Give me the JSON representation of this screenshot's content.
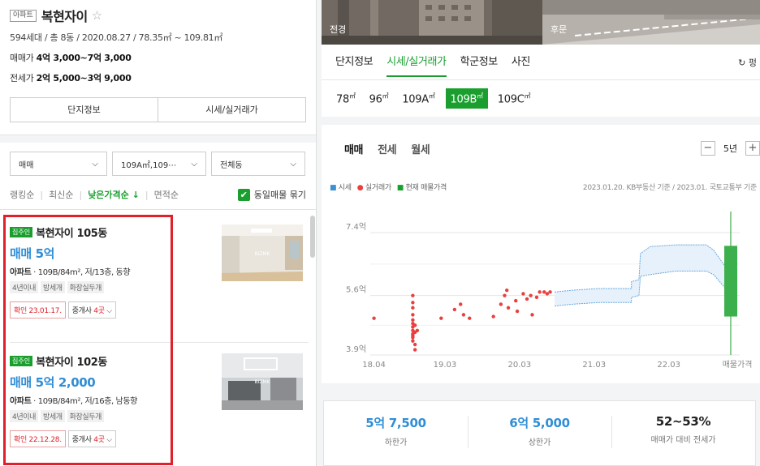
{
  "complex": {
    "type_badge": "아파트",
    "name": "복현자이",
    "meta": "594세대 / 총 8동 / 2020.08.27 / 78.35㎡ ~ 109.81㎡",
    "sale_label": "매매가",
    "sale_range": "4억 3,000~7억 3,000",
    "jeonse_label": "전세가",
    "jeonse_range": "2억 5,000~3억 9,000",
    "btn_info": "단지정보",
    "btn_price": "시세/실거래가"
  },
  "filters": {
    "trade": "매매",
    "size": "109A㎡,109⋯",
    "dong": "전체동"
  },
  "sort": {
    "ranking": "랭킹순",
    "latest": "최신순",
    "low_price": "낮은가격순",
    "low_price_arrow": "↓",
    "area": "면적순",
    "group_label": "동일매물 묶기"
  },
  "listings": [
    {
      "owner_badge": "집주인",
      "name": "복현자이 105동",
      "price": "매매 5억",
      "type": "아파트",
      "desc": "109B/84m², 저/13층, 동향",
      "tags": [
        "4년이내",
        "방세개",
        "화장실두개"
      ],
      "confirm": "확인 23.01.17.",
      "agents_prefix": "중개사 ",
      "agents_count": "4곳"
    },
    {
      "owner_badge": "집주인",
      "name": "복현자이 102동",
      "price": "매매 5억 2,000",
      "type": "아파트",
      "desc": "109B/84m², 저/16층, 남동향",
      "tags": [
        "4년이내",
        "방세개",
        "화장실두개"
      ],
      "confirm": "확인 22.12.28.",
      "agents_prefix": "중개사 ",
      "agents_count": "4곳"
    }
  ],
  "photos": {
    "front": "전경",
    "rear": "후문"
  },
  "tabs": [
    "단지정보",
    "시세/실거래가",
    "학군정보",
    "사진"
  ],
  "refresh_label": "펑",
  "sizes": [
    "78",
    "96",
    "109A",
    "109B",
    "109C"
  ],
  "size_unit": "㎡",
  "card_tabs": [
    "매매",
    "전세",
    "월세"
  ],
  "period": {
    "minus": "−",
    "value": "5년",
    "plus": "+"
  },
  "legend": {
    "market": "시세",
    "actual": "실거래가",
    "current": "현재 매물가격"
  },
  "basis": "2023.01.20. KB부동산 기준 / 2023.01. 국토교통부 기준",
  "chart_data": {
    "type": "scatter",
    "x_labels": [
      "18.04",
      "19.03",
      "20.03",
      "21.03",
      "22.03"
    ],
    "x_extra_label": "매물가격",
    "y_labels": [
      "7.4억",
      "5.6억",
      "3.9억"
    ],
    "ylim": [
      3.9,
      7.4
    ],
    "transactions": [
      {
        "x": 2018.3,
        "y": 4.95
      },
      {
        "x": 2018.82,
        "y": 5.6
      },
      {
        "x": 2018.82,
        "y": 5.4
      },
      {
        "x": 2018.82,
        "y": 5.25
      },
      {
        "x": 2018.82,
        "y": 5.05
      },
      {
        "x": 2018.82,
        "y": 4.9
      },
      {
        "x": 2018.82,
        "y": 4.8
      },
      {
        "x": 2018.82,
        "y": 4.7
      },
      {
        "x": 2018.82,
        "y": 4.6
      },
      {
        "x": 2018.82,
        "y": 4.5
      },
      {
        "x": 2018.82,
        "y": 4.45
      },
      {
        "x": 2018.82,
        "y": 4.4
      },
      {
        "x": 2018.82,
        "y": 4.3
      },
      {
        "x": 2018.85,
        "y": 4.55
      },
      {
        "x": 2018.85,
        "y": 4.75
      },
      {
        "x": 2018.85,
        "y": 4.2
      },
      {
        "x": 2018.85,
        "y": 4.05
      },
      {
        "x": 2018.88,
        "y": 4.6
      },
      {
        "x": 2019.2,
        "y": 4.95
      },
      {
        "x": 2019.38,
        "y": 5.2
      },
      {
        "x": 2019.46,
        "y": 5.35
      },
      {
        "x": 2019.5,
        "y": 5.05
      },
      {
        "x": 2019.58,
        "y": 4.95
      },
      {
        "x": 2019.9,
        "y": 5.0
      },
      {
        "x": 2020.0,
        "y": 5.35
      },
      {
        "x": 2020.05,
        "y": 5.6
      },
      {
        "x": 2020.08,
        "y": 5.75
      },
      {
        "x": 2020.1,
        "y": 5.25
      },
      {
        "x": 2020.2,
        "y": 5.45
      },
      {
        "x": 2020.22,
        "y": 5.15
      },
      {
        "x": 2020.3,
        "y": 5.65
      },
      {
        "x": 2020.35,
        "y": 5.5
      },
      {
        "x": 2020.4,
        "y": 5.6
      },
      {
        "x": 2020.42,
        "y": 5.05
      },
      {
        "x": 2020.48,
        "y": 5.55
      },
      {
        "x": 2020.52,
        "y": 5.7
      },
      {
        "x": 2020.58,
        "y": 5.7
      },
      {
        "x": 2020.62,
        "y": 5.65
      },
      {
        "x": 2020.66,
        "y": 5.7
      }
    ],
    "band_upper": [
      [
        2020.72,
        5.7
      ],
      [
        2020.95,
        5.75
      ],
      [
        2021.3,
        5.8
      ],
      [
        2021.75,
        5.8
      ],
      [
        2021.75,
        6.0
      ],
      [
        2021.85,
        6.05
      ],
      [
        2021.87,
        6.8
      ],
      [
        2022.0,
        7.0
      ],
      [
        2022.35,
        7.05
      ],
      [
        2022.45,
        7.05
      ],
      [
        2022.75,
        7.05
      ],
      [
        2022.85,
        6.9
      ],
      [
        2022.95,
        6.6
      ],
      [
        2023.05,
        6.3
      ]
    ],
    "band_lower": [
      [
        2020.72,
        5.3
      ],
      [
        2020.95,
        5.35
      ],
      [
        2021.3,
        5.4
      ],
      [
        2021.75,
        5.4
      ],
      [
        2021.75,
        5.55
      ],
      [
        2021.85,
        5.6
      ],
      [
        2021.87,
        6.15
      ],
      [
        2022.0,
        6.2
      ],
      [
        2022.35,
        6.3
      ],
      [
        2022.45,
        6.3
      ],
      [
        2022.75,
        6.3
      ],
      [
        2022.85,
        6.2
      ],
      [
        2022.95,
        5.95
      ],
      [
        2023.05,
        5.7
      ]
    ],
    "current_listing_range": [
      5.0,
      7.3
    ]
  },
  "stats": [
    {
      "value": "5억 7,500",
      "label": "하한가"
    },
    {
      "value": "6억 5,000",
      "label": "상한가"
    },
    {
      "value": "52~53%",
      "label": "매매가 대비 전세가"
    }
  ],
  "colors": {
    "accent_green": "#1a9f2f",
    "price_blue": "#2f8ed6",
    "dot_red": "#e84040",
    "highlight_red": "#e0202a"
  }
}
